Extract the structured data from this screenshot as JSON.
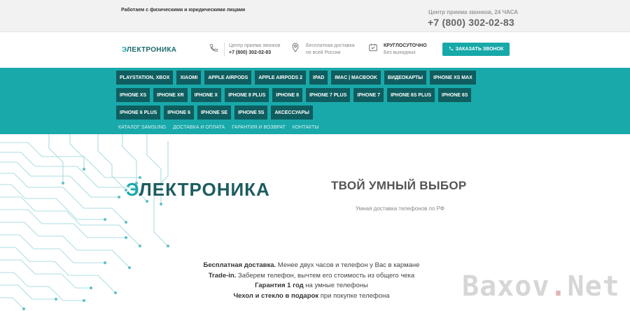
{
  "topbar": {
    "tagline": "Работаем с физическими и юридическими лицами",
    "call_center_label": "Центр приема звонков, 24 ЧАСА",
    "phone": "+7 (800) 302-02-83"
  },
  "header": {
    "logo": {
      "part1": "Э",
      "part2": "ЛЕКТРОНИКА"
    },
    "info": [
      {
        "icon": "phone-icon",
        "line1": "Центр приема звонков",
        "line2": "+7 (800) 302-02-83"
      },
      {
        "icon": "location-pin-icon",
        "line1": "Бесплатная доставка",
        "line2": "по всей России"
      },
      {
        "icon": "clock-icon",
        "line1": "КРУГЛОСУТОЧНО",
        "line2": "Без выходных"
      }
    ],
    "order_button": "ЗАКАЗАТЬ ЗВОНОК"
  },
  "nav": {
    "items": [
      "PLAYSTATION, XBOX",
      "XIAOMI",
      "APPLE AIRPODS",
      "APPLE AIRPODS 2",
      "IPAD",
      "IMAC | MACBOOK",
      "ВИДЕОКАРТЫ",
      "IPHONE XS MAX",
      "IPHONE XS",
      "IPHONE XR",
      "IPHONE X",
      "IPHONE 8 PLUS",
      "IPHONE 8",
      "IPHONE 7 PLUS",
      "IPHONE 7",
      "IPHONE 6S PLUS",
      "IPHONE 6S",
      "IPHONE 6 PLUS",
      "IPHONE 6",
      "IPHONE SE",
      "IPHONE 5S",
      "АКСЕССУАРЫ"
    ],
    "sub_links": [
      "КАТАЛОГ SAMSUNG",
      "ДОСТАВКА И ОПЛАТА",
      "ГАРАНТИЯ И ВОЗВРАТ",
      "КОНТАКТЫ"
    ]
  },
  "hero": {
    "logo": {
      "part1": "Э",
      "part2": "ЛЕКТРОНИКА"
    },
    "title": "ТВОЙ УМНЫЙ ВЫБОР",
    "subtitle": "Умная доставка телефонов по РФ",
    "benefits": [
      {
        "bold": "Бесплатная доставка.",
        "text": " Менее двух часов и телефон у Вас в кармане"
      },
      {
        "bold": "Trade-in.",
        "text": " Заберем телефон, вычтем его стоимость из общего чека"
      },
      {
        "bold": "Гарантия 1 год",
        "text": " на умные телефоны"
      },
      {
        "bold": "Чехол и стекло в подарок",
        "text": " при покупке телефона"
      }
    ],
    "watermark": {
      "part1": "Baxov",
      "dot": ".",
      "part2": "Net"
    }
  },
  "colors": {
    "teal": "#19a9aa",
    "dark_teal": "#0f5d5f",
    "logo_dark": "#1d5c60"
  }
}
